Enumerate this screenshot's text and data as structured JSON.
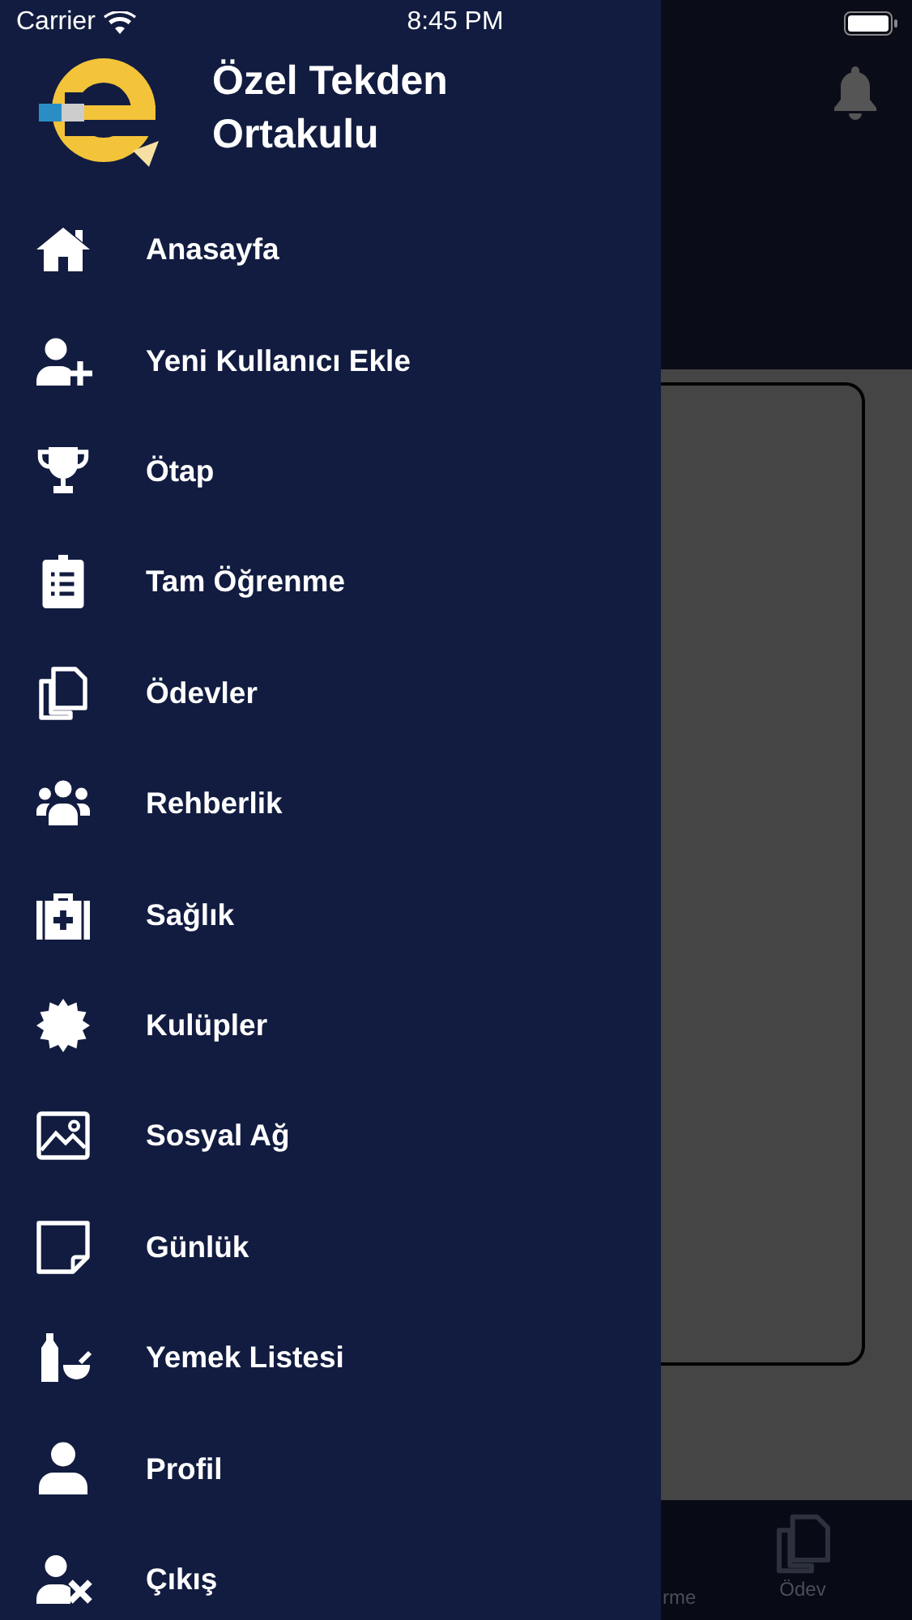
{
  "status_bar": {
    "carrier": "Carrier",
    "time": "8:45 PM"
  },
  "drawer": {
    "title": "Özel Tekden Ortakulu",
    "items": [
      {
        "kind": "home",
        "label": "Anasayfa"
      },
      {
        "kind": "adduser",
        "label": "Yeni Kullanıcı Ekle"
      },
      {
        "kind": "trophy",
        "label": "Ötap"
      },
      {
        "kind": "clipboard",
        "label": "Tam Öğrenme"
      },
      {
        "kind": "copy",
        "label": "Ödevler"
      },
      {
        "kind": "group",
        "label": "Rehberlik"
      },
      {
        "kind": "medkit",
        "label": "Sağlık"
      },
      {
        "kind": "burst",
        "label": "Kulüpler"
      },
      {
        "kind": "image",
        "label": "Sosyal Ağ"
      },
      {
        "kind": "note",
        "label": "Günlük"
      },
      {
        "kind": "food",
        "label": "Yemek Listesi"
      },
      {
        "kind": "user",
        "label": "Profil"
      },
      {
        "kind": "logout",
        "label": "Çıkış"
      }
    ]
  },
  "tab_bar": {
    "items": [
      {
        "kind": "text",
        "label": "rme"
      },
      {
        "kind": "copy",
        "label": "Ödev"
      }
    ]
  }
}
